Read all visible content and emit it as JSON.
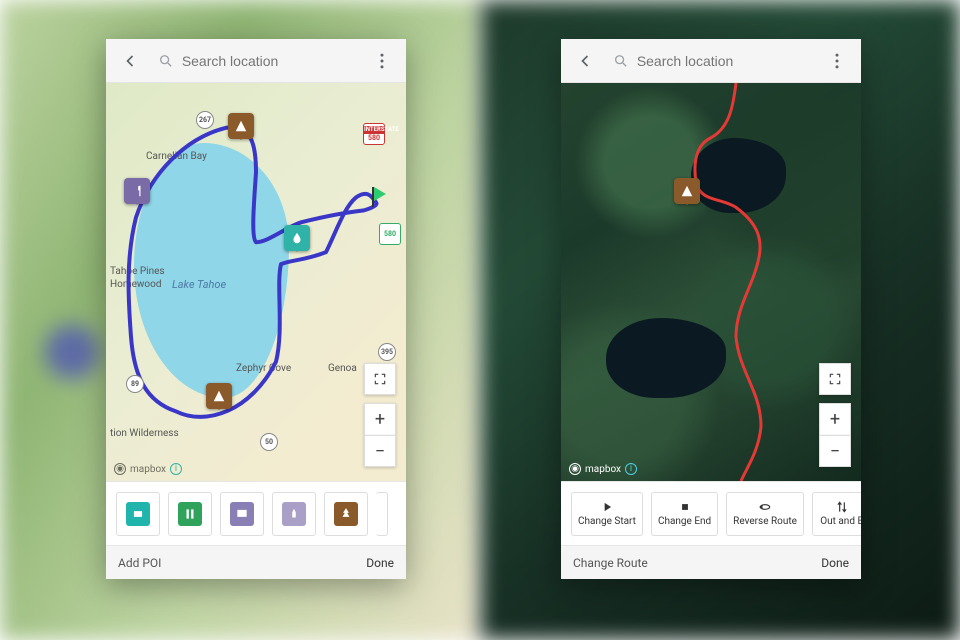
{
  "search_placeholder": "Search location",
  "attribution": "mapbox",
  "left": {
    "lake_label": "Lake Tahoe",
    "places": {
      "carnelian": "Carnelian Bay",
      "tahoe_pines": "Tahoe Pines",
      "homewood": "Homewood",
      "zephyr": "Zephyr Cove",
      "genoa": "Genoa",
      "wilderness": "tion Wilderness"
    },
    "shields": {
      "i580": "580",
      "us50": "50",
      "ca267": "267",
      "us395": "395",
      "ca89": "89"
    },
    "footer_left": "Add POI",
    "footer_right": "Done"
  },
  "right": {
    "tools": {
      "change_start": "Change Start",
      "change_end": "Change End",
      "reverse": "Reverse Route",
      "out_back": "Out and B"
    },
    "footer_left": "Change Route",
    "footer_right": "Done"
  },
  "icons": {
    "back": "arrow-left",
    "search": "magnify",
    "more": "dots-vertical",
    "fullscreen": "fullscreen",
    "plus": "+",
    "minus": "−"
  }
}
